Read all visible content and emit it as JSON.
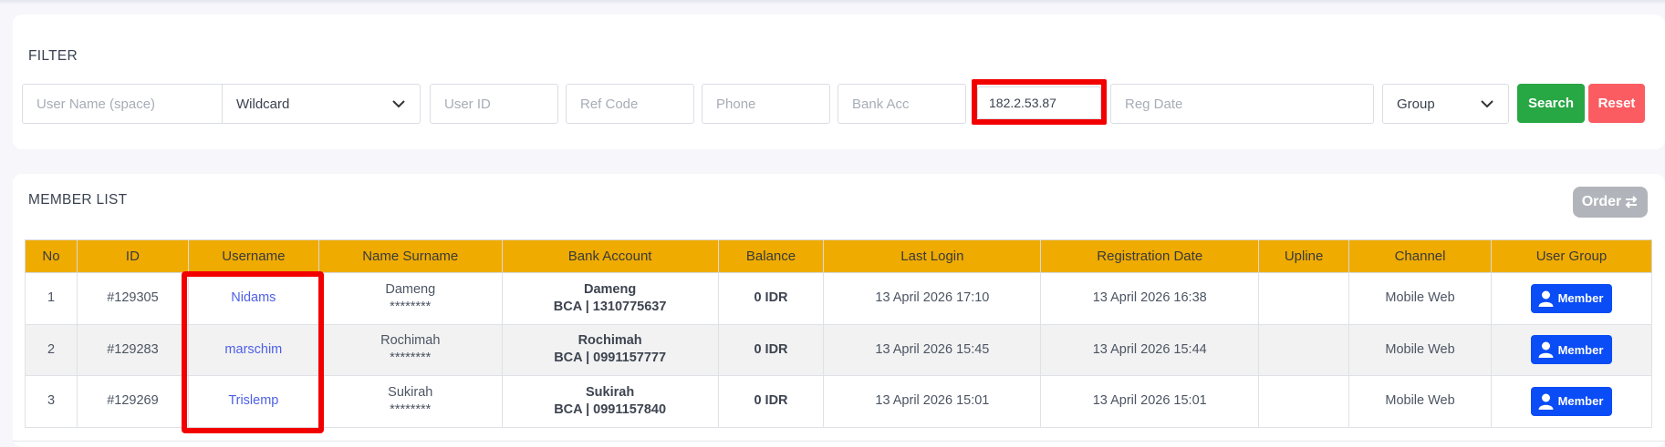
{
  "filter": {
    "title": "FILTER",
    "username_placeholder": "User Name (space)",
    "match_mode": "Wildcard",
    "user_id_placeholder": "User ID",
    "ref_code_placeholder": "Ref Code",
    "phone_placeholder": "Phone",
    "bank_acc_placeholder": "Bank Acc",
    "ip_value": "182.2.53.87",
    "reg_date_placeholder": "Reg Date",
    "group": "Group",
    "search_label": "Search",
    "reset_label": "Reset"
  },
  "member_list": {
    "title": "MEMBER LIST",
    "order_label": "Order",
    "columns": [
      "No",
      "ID",
      "Username",
      "Name Surname",
      "Bank Account",
      "Balance",
      "Last Login",
      "Registration Date",
      "Upline",
      "Channel",
      "User Group"
    ],
    "rows": [
      {
        "no": "1",
        "id": "#129305",
        "username": "Nidams",
        "name": "Dameng",
        "masked": "********",
        "bank_name": "Dameng",
        "bank_acc": "BCA | 1310775637",
        "balance": "0 IDR",
        "last_login": "13 April 2026 17:10",
        "reg_date": "13 April 2026 16:38",
        "upline": "",
        "channel": "Mobile Web",
        "group": "Member"
      },
      {
        "no": "2",
        "id": "#129283",
        "username": "marschim",
        "name": "Rochimah",
        "masked": "********",
        "bank_name": "Rochimah",
        "bank_acc": "BCA | 0991157777",
        "balance": "0 IDR",
        "last_login": "13 April 2026 15:45",
        "reg_date": "13 April 2026 15:44",
        "upline": "",
        "channel": "Mobile Web",
        "group": "Member"
      },
      {
        "no": "3",
        "id": "#129269",
        "username": "Trislemp",
        "name": "Sukirah",
        "masked": "********",
        "bank_name": "Sukirah",
        "bank_acc": "BCA | 0991157840",
        "balance": "0 IDR",
        "last_login": "13 April 2026 15:01",
        "reg_date": "13 April 2026 15:01",
        "upline": "",
        "channel": "Mobile Web",
        "group": "Member"
      }
    ]
  },
  "colors": {
    "header_bg": "#efab00",
    "search_btn": "#28a745",
    "reset_btn": "#fb5c62",
    "member_badge": "#0a4cf5",
    "highlight_box": "#f20000",
    "username_link": "#4d5fe8"
  }
}
